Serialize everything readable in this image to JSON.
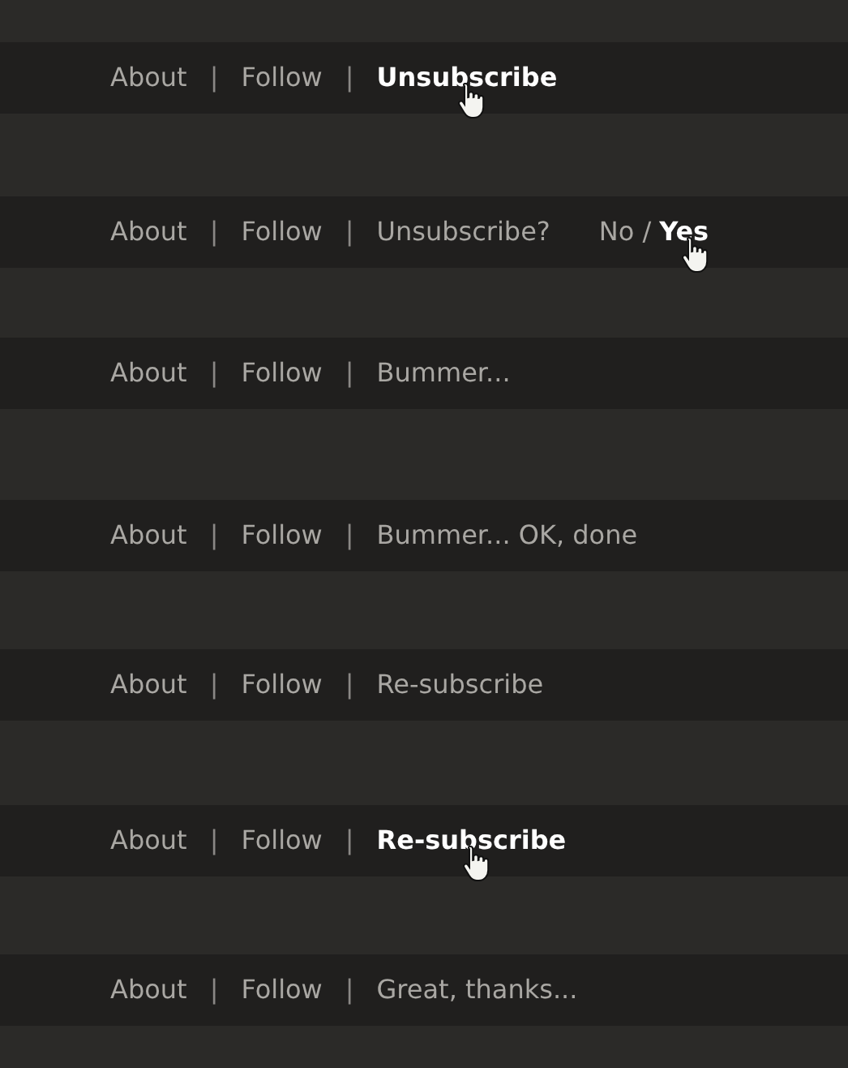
{
  "rows": [
    {
      "links": [
        "About",
        "Follow"
      ],
      "separators": [
        "|",
        "|"
      ],
      "action": {
        "kind": "link",
        "label": "Unsubscribe",
        "hovered": true
      }
    },
    {
      "links": [
        "About",
        "Follow"
      ],
      "separators": [
        "|",
        "|"
      ],
      "action": {
        "kind": "confirm",
        "label": "Unsubscribe?",
        "divider": "/",
        "options": [
          {
            "label": "No",
            "hovered": false
          },
          {
            "label": "Yes",
            "hovered": true
          }
        ]
      }
    },
    {
      "links": [
        "About",
        "Follow"
      ],
      "separators": [
        "|",
        "|"
      ],
      "action": {
        "kind": "text",
        "label": "Bummer..."
      }
    },
    {
      "links": [
        "About",
        "Follow"
      ],
      "separators": [
        "|",
        "|"
      ],
      "action": {
        "kind": "text",
        "label": "Bummer... OK, done"
      }
    },
    {
      "links": [
        "About",
        "Follow"
      ],
      "separators": [
        "|",
        "|"
      ],
      "action": {
        "kind": "link",
        "label": "Re-subscribe",
        "hovered": false
      }
    },
    {
      "links": [
        "About",
        "Follow"
      ],
      "separators": [
        "|",
        "|"
      ],
      "action": {
        "kind": "link",
        "label": "Re-subscribe",
        "hovered": true
      }
    },
    {
      "links": [
        "About",
        "Follow"
      ],
      "separators": [
        "|",
        "|"
      ],
      "action": {
        "kind": "text",
        "label": "Great, thanks..."
      }
    }
  ]
}
